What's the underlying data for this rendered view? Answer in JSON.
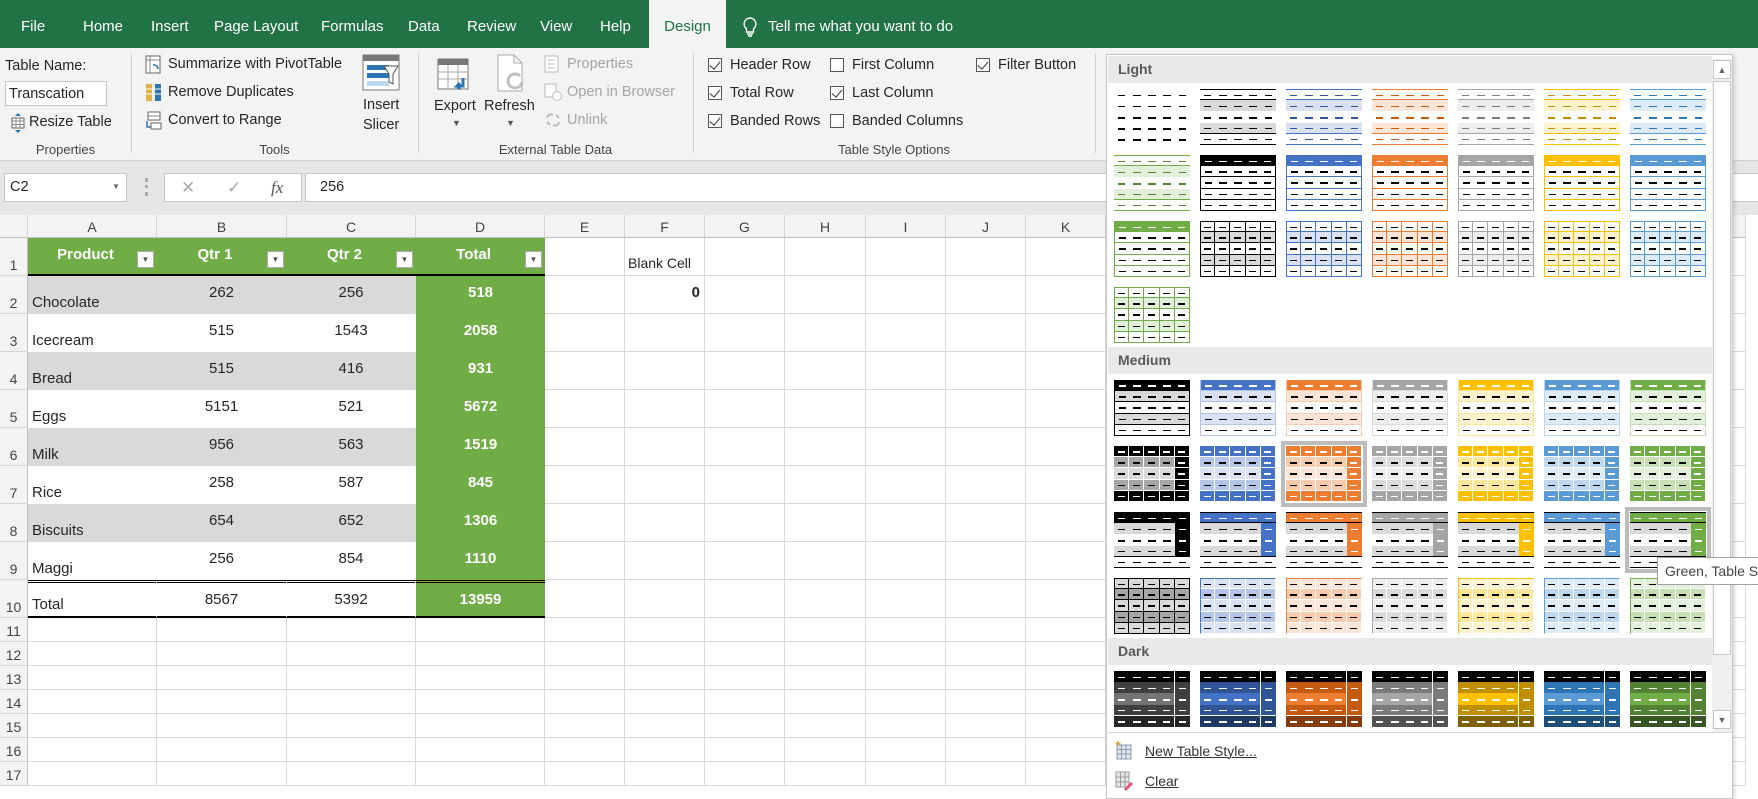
{
  "tabs": [
    "File",
    "Home",
    "Insert",
    "Page Layout",
    "Formulas",
    "Data",
    "Review",
    "View",
    "Help",
    "Design"
  ],
  "tell_me": "Tell me what you want to do",
  "ribbon": {
    "properties": {
      "table_name_label": "Table Name:",
      "table_name_value": "Transcation",
      "resize_label": "Resize Table",
      "group_label": "Properties"
    },
    "tools": {
      "pivot": "Summarize with PivotTable",
      "remove_dup": "Remove Duplicates",
      "convert": "Convert to Range",
      "slicer_1": "Insert",
      "slicer_2": "Slicer",
      "group_label": "Tools"
    },
    "external": {
      "export": "Export",
      "refresh": "Refresh",
      "properties": "Properties",
      "open_browser": "Open in Browser",
      "unlink": "Unlink",
      "group_label": "External Table Data"
    },
    "style_options": {
      "options": [
        {
          "label": "Header Row",
          "checked": true
        },
        {
          "label": "Total Row",
          "checked": true
        },
        {
          "label": "Banded Rows",
          "checked": true
        },
        {
          "label": "First Column",
          "checked": false
        },
        {
          "label": "Last Column",
          "checked": true
        },
        {
          "label": "Banded Columns",
          "checked": false
        },
        {
          "label": "Filter Button",
          "checked": true
        }
      ],
      "group_label": "Table Style Options"
    }
  },
  "formula_bar": {
    "name_box": "C2",
    "cancel": "✕",
    "enter": "✓",
    "fx": "fx",
    "value": "256"
  },
  "sheet": {
    "columns": [
      "A",
      "B",
      "C",
      "D",
      "E",
      "F",
      "G",
      "H",
      "I",
      "J",
      "K"
    ],
    "row_numbers": [
      "1",
      "2",
      "3",
      "4",
      "5",
      "6",
      "7",
      "8",
      "9",
      "10",
      "11",
      "12",
      "13",
      "14",
      "15",
      "16",
      "17"
    ],
    "table": {
      "headers": [
        "Product",
        "Qtr 1",
        "Qtr 2",
        "Total"
      ],
      "rows": [
        [
          "Chocolate",
          "262",
          "256",
          "518"
        ],
        [
          "Icecream",
          "515",
          "1543",
          "2058"
        ],
        [
          "Bread",
          "515",
          "416",
          "931"
        ],
        [
          "Eggs",
          "5151",
          "521",
          "5672"
        ],
        [
          "Milk",
          "956",
          "563",
          "1519"
        ],
        [
          "Rice",
          "258",
          "587",
          "845"
        ],
        [
          "Biscuits",
          "654",
          "652",
          "1306"
        ],
        [
          "Maggi",
          "256",
          "854",
          "1110"
        ],
        [
          "Total",
          "8567",
          "5392",
          "13959"
        ]
      ]
    },
    "f1": "Blank Cell",
    "f2": "0"
  },
  "gallery": {
    "sections": [
      "Light",
      "Medium",
      "Dark"
    ],
    "tooltip": "Green, Table St",
    "new_style": "New Table Style...",
    "clear": "Clear",
    "palette": [
      {
        "name": "black",
        "base": "#000000",
        "light": "#d9d9d9",
        "mid": "#a6a6a6",
        "dark": "#404040",
        "darker": "#262626",
        "rowdark": "#737373"
      },
      {
        "name": "blue",
        "base": "#4472c4",
        "light": "#d9e1f2",
        "mid": "#b4c6e7",
        "dark": "#2f5597",
        "darker": "#203864",
        "rowdark": "#4472c4"
      },
      {
        "name": "orange",
        "base": "#ed7d31",
        "light": "#fce4d6",
        "mid": "#f8cbad",
        "dark": "#c55a11",
        "darker": "#843c0c",
        "rowdark": "#ed7d31"
      },
      {
        "name": "gray",
        "base": "#a5a5a5",
        "light": "#ededed",
        "mid": "#dbdbdb",
        "dark": "#7b7b7b",
        "darker": "#525252",
        "rowdark": "#a5a5a5"
      },
      {
        "name": "yellow",
        "base": "#ffc000",
        "light": "#fff2cc",
        "mid": "#ffe699",
        "dark": "#bf8f00",
        "darker": "#7f6000",
        "rowdark": "#ffc000"
      },
      {
        "name": "lightblue",
        "base": "#5b9bd5",
        "light": "#ddebf7",
        "mid": "#bdd7ee",
        "dark": "#2e75b6",
        "darker": "#1f4e79",
        "rowdark": "#5b9bd5"
      },
      {
        "name": "green",
        "base": "#70ad47",
        "light": "#e2efda",
        "mid": "#c6e0b4",
        "dark": "#548235",
        "darker": "#375623",
        "rowdark": "#70ad47"
      }
    ]
  }
}
